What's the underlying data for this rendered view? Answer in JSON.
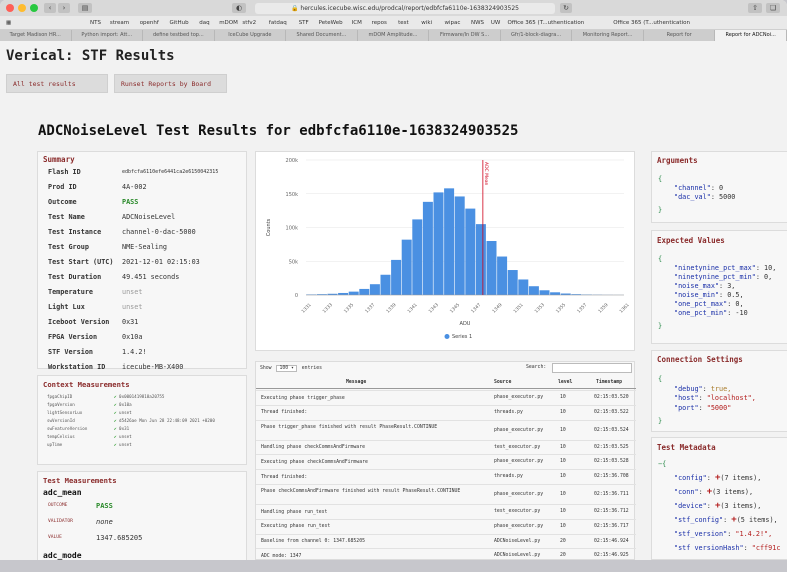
{
  "browser": {
    "url": "hercules.icecube.wisc.edu/prodcal/report/edbfcfa6110e-1638324903525",
    "bookmarks": [
      "NTS",
      "stream",
      "openhf",
      "GitHub",
      "daq",
      "mDOM",
      "stfv2",
      "fatdaq",
      "STF",
      "PeteWeb",
      "ICM",
      "repos",
      "test",
      "wiki",
      "wipac",
      "NWS",
      "UW",
      "Office 365 (T...uthentication",
      "Office 365 (T...uthentication"
    ],
    "tabs": [
      "Target Madison HR...",
      "Python import: Att...",
      "define testbed top...",
      "IceCube Upgrade",
      "Shared Document...",
      "mDOM Amplitude...",
      "Firmware/In DW S...",
      "Gfr/1-block-diagra...",
      "Monitoring Report...",
      "Report for",
      "Report for ADCNoi..."
    ]
  },
  "site": {
    "title": "Verical: STF Results",
    "nav": [
      "All test results",
      "Runset Reports by Board"
    ]
  },
  "heading": "ADCNoiseLevel Test Results for edbfcfa6110e-1638324903525",
  "summary": {
    "title": "Summary",
    "rows": [
      {
        "label": "Flash ID",
        "value": "edbfcfa6110efe6441ca2e6150042315",
        "style": "small"
      },
      {
        "label": "Prod ID",
        "value": "4A-002",
        "style": ""
      },
      {
        "label": "Outcome",
        "value": "PASS",
        "style": "pass"
      },
      {
        "label": "Test Name",
        "value": "ADCNoiseLevel",
        "style": ""
      },
      {
        "label": "Test Instance",
        "value": "channel-0-dac-5000",
        "style": ""
      },
      {
        "label": "Test Group",
        "value": "NME-Sealing",
        "style": ""
      },
      {
        "label": "Test Start (UTC)",
        "value": "2021-12-01 02:15:03",
        "style": ""
      },
      {
        "label": "Test Duration",
        "value": "49.451 seconds",
        "style": ""
      },
      {
        "label": "Temperature",
        "value": "unset",
        "style": "grey"
      },
      {
        "label": "Light Lux",
        "value": "unset",
        "style": "grey"
      },
      {
        "label": "Iceboot Version",
        "value": "0x31",
        "style": ""
      },
      {
        "label": "FPGA Version",
        "value": "0x10a",
        "style": ""
      },
      {
        "label": "STF Version",
        "value": "1.4.2!",
        "style": ""
      },
      {
        "label": "Workstation ID",
        "value": "icecube-MB-X400",
        "style": ""
      }
    ]
  },
  "context": {
    "title": "Context Measurements",
    "rows": [
      {
        "key": "fpgaChipID",
        "value": "0x0001419818a20755"
      },
      {
        "key": "fpgaVersion",
        "value": "0x10a"
      },
      {
        "key": "lightSensorLux",
        "value": "unset"
      },
      {
        "key": "swVersionId",
        "value": "d5426ae Mon Jun 28 22:48:09 2021 +0200"
      },
      {
        "key": "swFeatureVersion",
        "value": "0x31"
      },
      {
        "key": "tempCelsius",
        "value": "unset"
      },
      {
        "key": "upTime",
        "value": "unset"
      }
    ]
  },
  "test_measurements": {
    "title": "Test Measurements",
    "name": "adc_mean",
    "outcome_label": "OUTCOME",
    "outcome": "PASS",
    "validator_label": "VALIDATOR",
    "validator": "none",
    "value_label": "VALUE",
    "value": "1347.685205",
    "next_name": "adc_mode"
  },
  "chart_data": {
    "type": "bar",
    "xlabel": "ADU",
    "ylabel": "Counts",
    "ylim": [
      0,
      200000
    ],
    "yticks": [
      "0",
      "50k",
      "100k",
      "150k",
      "200k"
    ],
    "categories": [
      "1331",
      "1333",
      "1335",
      "1337",
      "1339",
      "1341",
      "1343",
      "1345",
      "1347",
      "1349",
      "1351",
      "1353",
      "1355",
      "1357",
      "1359",
      "1361"
    ],
    "bin_edges_start": 1331,
    "bin_width": 1,
    "values": [
      800,
      1200,
      1800,
      3000,
      5000,
      9000,
      16000,
      30000,
      52000,
      82000,
      112000,
      138000,
      152000,
      158000,
      146000,
      128000,
      105000,
      80000,
      57000,
      37000,
      23000,
      13000,
      7000,
      4000,
      2200,
      1200,
      700,
      400,
      200,
      100
    ],
    "vline_label": "ADC Mean",
    "vline_x": 1347.685205,
    "legend": "Series 1",
    "legend_position": "bottom",
    "bar_color": "#4a90e2",
    "vline_color": "#d0021b"
  },
  "log_table": {
    "show_label": "Show",
    "show_value": "100",
    "entries_label": "entries",
    "search_label": "Search:",
    "columns": [
      "Message",
      "Source",
      "level",
      "Timestamp"
    ],
    "rows": [
      [
        "Executing phase trigger_phase",
        "phase_executor.py",
        "10",
        "02:15:03.520"
      ],
      [
        "Thread finished:",
        "threads.py",
        "10",
        "02:15:03.522"
      ],
      [
        "Phase trigger_phase finished with result PhaseResult.CONTINUE",
        "phase_executor.py",
        "10",
        "02:15:03.524"
      ],
      [
        "Handling phase checkCommsAndFirmware",
        "test_executor.py",
        "10",
        "02:15:03.525"
      ],
      [
        "Executing phase checkCommsAndFirmware",
        "phase_executor.py",
        "10",
        "02:15:03.528"
      ],
      [
        "Thread finished:",
        "threads.py",
        "10",
        "02:15:36.708"
      ],
      [
        "Phase checkCommsAndFirmware finished with result PhaseResult.CONTINUE",
        "phase_executor.py",
        "10",
        "02:15:36.711"
      ],
      [
        "Handling phase run_test",
        "test_executor.py",
        "10",
        "02:15:36.712"
      ],
      [
        "Executing phase run_test",
        "phase_executor.py",
        "10",
        "02:15:36.717"
      ],
      [
        "Baseline from channel 0: 1347.685205",
        "ADCNoiseLevel.py",
        "20",
        "02:15:46.924"
      ],
      [
        "ADC mode: 1347",
        "ADCNoiseLevel.py",
        "20",
        "02:15:46.925"
      ]
    ]
  },
  "arguments": {
    "title": "Arguments",
    "items": [
      {
        "key": "\"channel\"",
        "value": "0"
      },
      {
        "key": "\"dac_val\"",
        "value": "5000"
      }
    ]
  },
  "expected_values": {
    "title": "Expected Values",
    "items": [
      {
        "key": "\"ninetynine_pct_max\"",
        "value": "10,"
      },
      {
        "key": "\"ninetynine_pct_min\"",
        "value": "0,"
      },
      {
        "key": "\"noise_max\"",
        "value": "3,"
      },
      {
        "key": "\"noise_min\"",
        "value": "0.5,"
      },
      {
        "key": "\"one_pct_max\"",
        "value": "0,"
      },
      {
        "key": "\"one_pct_min\"",
        "value": "-10"
      }
    ]
  },
  "connection_settings": {
    "title": "Connection Settings",
    "items": [
      {
        "key": "\"debug\"",
        "value": "true,",
        "type": "t"
      },
      {
        "key": "\"host\"",
        "value": "\"localhost\",",
        "type": "s"
      },
      {
        "key": "\"port\"",
        "value": "\"5000\"",
        "type": "s"
      }
    ]
  },
  "test_metadata": {
    "title": "Test Metadata",
    "items": [
      {
        "key": "\"config\"",
        "value": "+(7 items),"
      },
      {
        "key": "\"conn\"",
        "value": "+(3 items),"
      },
      {
        "key": "\"device\"",
        "value": "+(3 items),"
      },
      {
        "key": "\"stf_config\"",
        "value": "+(5 items),"
      },
      {
        "key": "\"stf_version\"",
        "value": "\"1.4.2!\","
      },
      {
        "key": "\"stf versionHash\"",
        "value": "\"cff91c"
      }
    ]
  }
}
